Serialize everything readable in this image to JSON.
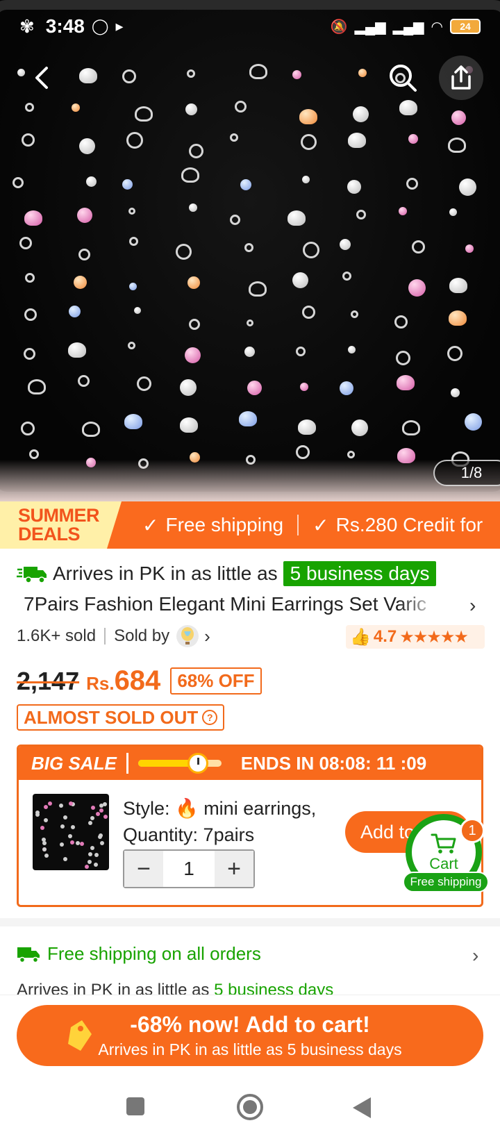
{
  "status_bar": {
    "time": "3:48",
    "battery": "24"
  },
  "hero": {
    "image_counter": "1/8"
  },
  "banner": {
    "deal_line1": "SUMMER",
    "deal_line2": "DEALS",
    "features": [
      "Free shipping",
      "Rs.280 Credit for"
    ]
  },
  "product": {
    "arrive_prefix": "Arrives in PK in as little as",
    "arrive_days": "5 business days",
    "title": "7Pairs Fashion Elegant Mini Earrings Set Varic",
    "sold": "1.6K+ sold",
    "sold_by": "Sold by",
    "rating": "4.7",
    "stars": "★★★★★",
    "old_price": "2,147",
    "currency": "Rs.",
    "new_price": "684",
    "discount": "68% OFF",
    "stock_warning": "ALMOST SOLD OUT"
  },
  "big_sale": {
    "label": "BIG SALE",
    "timer_progress": 0.72,
    "ends_label": "ENDS IN 08:08: 11 :09",
    "style_label": "Style:",
    "style_value": "mini earrings,",
    "quantity_label": "Quantity: 7pairs",
    "qty_value": "1",
    "minus": "−",
    "plus": "+",
    "add_label": "Add to"
  },
  "cart": {
    "count": "1",
    "label": "Cart",
    "free_shipping": "Free shipping"
  },
  "shipping": {
    "title": "Free shipping on all orders",
    "sub_prefix": "Arrives in PK in as little as",
    "sub_days": "5 business days"
  },
  "cta": {
    "line1": "-68% now! Add to cart!",
    "line2": "Arrives in PK in as little as 5 business days"
  },
  "colors": {
    "accent": "#f86a1c",
    "green": "#18a300",
    "price": "#f26a1b"
  }
}
